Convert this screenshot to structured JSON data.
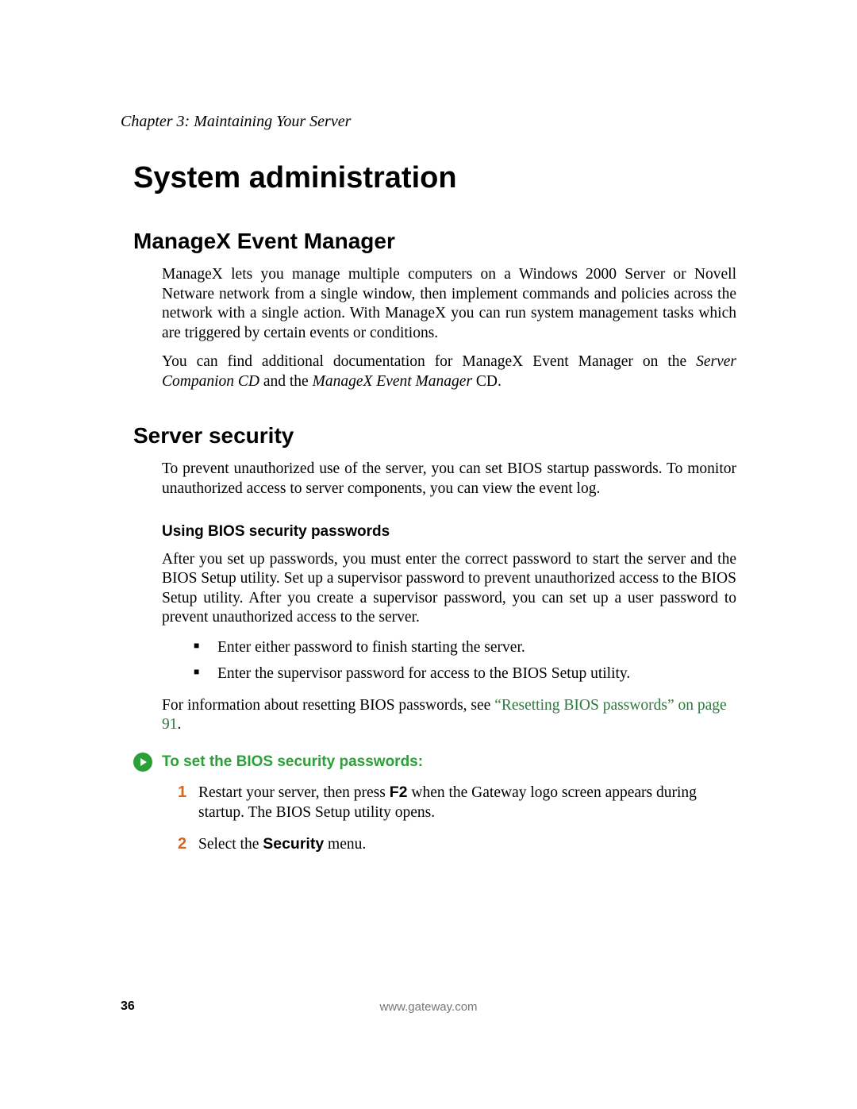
{
  "chapter_header": "Chapter 3: Maintaining Your Server",
  "h1": "System administration",
  "managex": {
    "heading": "ManageX Event Manager",
    "para1": "ManageX lets you manage multiple computers on a Windows 2000 Server or Novell Netware network from a single window, then implement commands and policies across the network with a single action. With ManageX you can run system management tasks which are triggered by certain events or conditions.",
    "para2_pre": "You can find additional documentation for ManageX Event Manager on the ",
    "cd1": "Server Companion CD",
    "para2_mid": " and the ",
    "cd2": "ManageX Event Manager",
    "para2_post": " CD."
  },
  "security": {
    "heading": "Server security",
    "intro": "To prevent unauthorized use of the server, you can set BIOS startup passwords. To monitor unauthorized access to server components, you can view the event log.",
    "bios": {
      "heading": "Using BIOS security passwords",
      "para": "After you set up passwords, you must enter the correct password to start the server and the BIOS Setup utility. Set up a supervisor password to prevent unauthorized access to the BIOS Setup utility. After you create a supervisor password, you can set up a user password to prevent unauthorized access to the server.",
      "bullets": [
        "Enter either password to finish starting the server.",
        "Enter the supervisor password for access to the BIOS Setup utility."
      ],
      "ref_pre": "For information about resetting BIOS passwords, see ",
      "ref_link": "“Resetting BIOS passwords” on page 91",
      "ref_post": "."
    },
    "procedure": {
      "title": "To set the BIOS security passwords:",
      "steps": [
        {
          "num": "1",
          "pre": "Restart your server, then press ",
          "kbd": "F2",
          "post": " when the Gateway logo screen appears during startup. The BIOS Setup utility opens."
        },
        {
          "num": "2",
          "pre": "Select the ",
          "menu": "Security",
          "post": " menu."
        }
      ]
    }
  },
  "footer": {
    "page": "36",
    "url": "www.gateway.com"
  }
}
